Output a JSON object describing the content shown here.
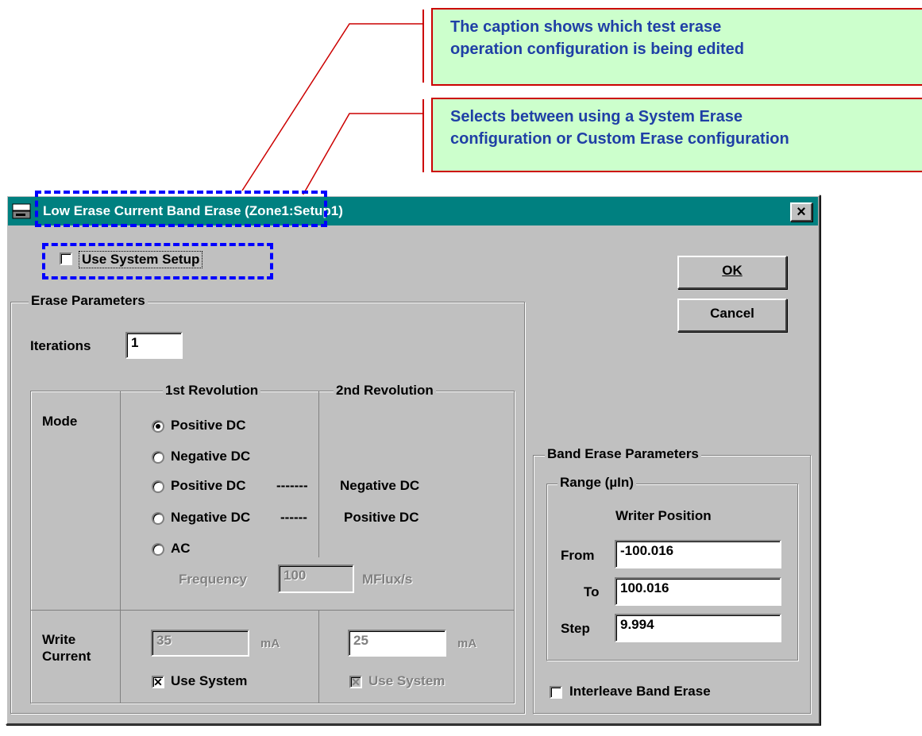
{
  "callouts": [
    {
      "text_line1": "The caption shows which test erase",
      "text_line2": "operation configuration is being edited"
    },
    {
      "text_line1": "Selects between using a System Erase",
      "text_line2": "configuration or Custom Erase configuration"
    }
  ],
  "window": {
    "title": "Low Erase Current Band Erase (Zone1:Setup1)",
    "close_glyph": "×",
    "use_system_setup": {
      "label": "Use System Setup",
      "checked": false
    },
    "ok_label": "OK",
    "cancel_label": "Cancel",
    "erase_parameters": {
      "legend": "Erase Parameters",
      "iterations_label": "Iterations",
      "iterations_value": "1",
      "first_rev_label": "1st Revolution",
      "second_rev_label": "2nd Revolution",
      "mode_label": "Mode",
      "modes": [
        "Positive DC",
        "Negative DC",
        "Positive DC",
        "Negative DC",
        "AC"
      ],
      "mode_dash_1": "-------",
      "mode_second_1": "Negative DC",
      "mode_dash_2": "------",
      "mode_second_2": "Positive DC",
      "selected_mode": "Positive DC",
      "frequency_label": "Frequency",
      "frequency_value": "100",
      "frequency_unit": "MFlux/s",
      "write_current_label1": "Write",
      "write_current_label2": "Current",
      "write_current_1": "35",
      "write_current_2": "25",
      "unit_ma": "mA",
      "use_system_label": "Use System",
      "check_glyph": "✕"
    },
    "band_erase": {
      "legend": "Band Erase Parameters",
      "range_legend": "Range (µIn)",
      "writer_position_label": "Writer Position",
      "from_label": "From",
      "from_value": "-100.016",
      "to_label": "To",
      "to_value": "100.016",
      "step_label": "Step",
      "step_value": "9.994",
      "interleave_label": "Interleave Band Erase"
    }
  },
  "colors": {
    "title_bar": "#008080",
    "callout_bg": "#ccffcc",
    "callout_text": "#1f3fa6",
    "leader": "#cc0000",
    "highlight": "#0000ff"
  }
}
